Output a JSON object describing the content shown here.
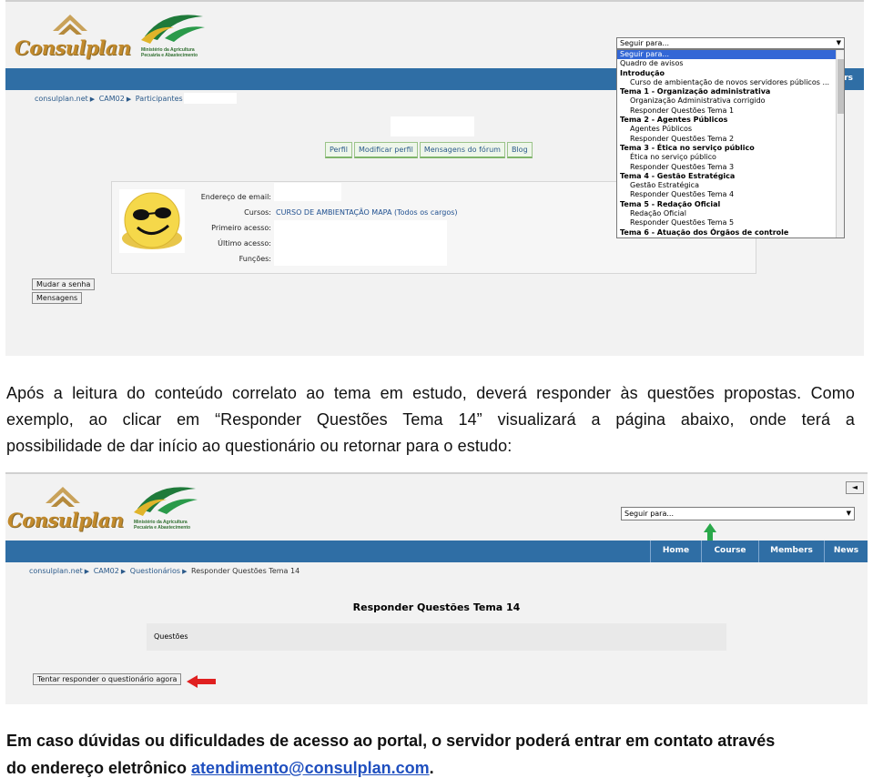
{
  "shot1": {
    "consulplan_logo": "Consulplan",
    "ministry_logo": "Ministério da Agricultura Pecuária e Abastecimento",
    "breadcrumb": [
      "consulplan.net",
      "CAM02",
      "Participantes"
    ],
    "tabs": [
      "Perfil",
      "Modificar perfil",
      "Mensagens do fórum",
      "Blog"
    ],
    "profile": {
      "email_label": "Endereço de email:",
      "courses_label": "Cursos:",
      "courses_value": "CURSO DE AMBIENTAÇÃO MAPA (Todos os cargos)",
      "first_access_label": "Primeiro acesso:",
      "last_access_label": "Último acesso:",
      "roles_label": "Funções:"
    },
    "buttons": {
      "change_password": "Mudar a senha",
      "messages": "Mensagens"
    },
    "nav_partial": "ers",
    "dropdown": {
      "placeholder": "Seguir para...",
      "items": [
        {
          "text": "Seguir para...",
          "kind": "sel"
        },
        {
          "text": "Quadro de avisos",
          "kind": "head"
        },
        {
          "text": "Introdução",
          "kind": "grp"
        },
        {
          "text": "Curso de ambientação de novos servidores públicos ...",
          "kind": "opt"
        },
        {
          "text": "Tema 1 - Organização administrativa",
          "kind": "grp"
        },
        {
          "text": "Organização Administrativa corrigido",
          "kind": "opt"
        },
        {
          "text": "Responder Questões Tema 1",
          "kind": "opt"
        },
        {
          "text": "Tema 2 - Agentes Públicos",
          "kind": "grp"
        },
        {
          "text": "Agentes Públicos",
          "kind": "opt"
        },
        {
          "text": "Responder Questões Tema 2",
          "kind": "opt"
        },
        {
          "text": "Tema 3 - Ética no serviço público",
          "kind": "grp"
        },
        {
          "text": "Ética no serviço público",
          "kind": "opt"
        },
        {
          "text": "Responder Questões Tema 3",
          "kind": "opt"
        },
        {
          "text": "Tema 4 - Gestão Estratégica",
          "kind": "grp"
        },
        {
          "text": "Gestão Estratégica",
          "kind": "opt"
        },
        {
          "text": "Responder Questões Tema 4",
          "kind": "opt"
        },
        {
          "text": "Tema 5 - Redação Oficial",
          "kind": "grp"
        },
        {
          "text": "Redação Oficial",
          "kind": "opt"
        },
        {
          "text": "Responder Questões Tema 5",
          "kind": "opt"
        },
        {
          "text": "Tema 6 - Atuação dos Órgãos de controle",
          "kind": "grp"
        }
      ]
    }
  },
  "paragraph1": {
    "line1": "Após a leitura do conteúdo correlato ao tema em estudo, deverá responder às questões propostas. Como",
    "line2": "exemplo, ao clicar em “Responder Questões Tema 14” visualizará a página abaixo, onde terá a",
    "line3": "possibilidade de dar início ao questionário ou retornar para o estudo:"
  },
  "shot2": {
    "select_placeholder": "Seguir para...",
    "nav": [
      "Home",
      "Course",
      "Members",
      "News"
    ],
    "breadcrumb": [
      "consulplan.net",
      "CAM02",
      "Questionários",
      "Responder Questões Tema 14"
    ],
    "page_title": "Responder Questões Tema 14",
    "questions_label": "Questões",
    "start_button": "Tentar responder o questionário agora",
    "back_glyph": "◄",
    "colors": {
      "nav_blue": "#2f6ea5",
      "arrow_green": "#2aa84a",
      "arrow_red": "#e02020"
    }
  },
  "paragraph2": {
    "line1": "Em caso dúvidas ou dificuldades de acesso ao portal, o servidor poderá entrar em contato através",
    "line2_prefix": "do endereço eletrônico ",
    "email": "atendimento@consulplan.com",
    "line2_suffix": "."
  }
}
